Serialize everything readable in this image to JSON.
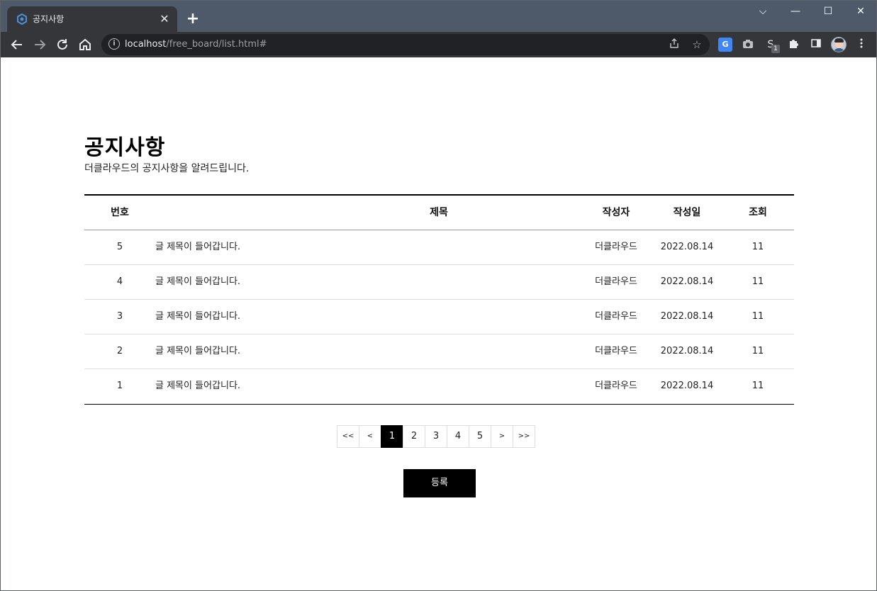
{
  "browser": {
    "tab_title": "공지사항",
    "tab_close": "✕",
    "new_tab": "+",
    "url_host": "localhost",
    "url_path": "/free_board/list.html#",
    "window_controls": {
      "dropdown": "⌵",
      "minimize": "—",
      "maximize": "☐",
      "close": "✕"
    },
    "extension_badge": "1",
    "extension_letter": "S"
  },
  "board": {
    "title": "공지사항",
    "description": "더클라우드의 공지사항을 알려드립니다.",
    "columns": {
      "num": "번호",
      "title": "제목",
      "author": "작성자",
      "date": "작성일",
      "views": "조회"
    },
    "rows": [
      {
        "num": "5",
        "title": "글 제목이 들어갑니다.",
        "author": "더클라우드",
        "date": "2022.08.14",
        "views": "11"
      },
      {
        "num": "4",
        "title": "글 제목이 들어갑니다.",
        "author": "더클라우드",
        "date": "2022.08.14",
        "views": "11"
      },
      {
        "num": "3",
        "title": "글 제목이 들어갑니다.",
        "author": "더클라우드",
        "date": "2022.08.14",
        "views": "11"
      },
      {
        "num": "2",
        "title": "글 제목이 들어갑니다.",
        "author": "더클라우드",
        "date": "2022.08.14",
        "views": "11"
      },
      {
        "num": "1",
        "title": "글 제목이 들어갑니다.",
        "author": "더클라우드",
        "date": "2022.08.14",
        "views": "11"
      }
    ],
    "pagination": {
      "first": "<<",
      "prev": "<",
      "pages": [
        "1",
        "2",
        "3",
        "4",
        "5"
      ],
      "current": "1",
      "next": ">",
      "last": ">>"
    },
    "submit_label": "등록"
  }
}
